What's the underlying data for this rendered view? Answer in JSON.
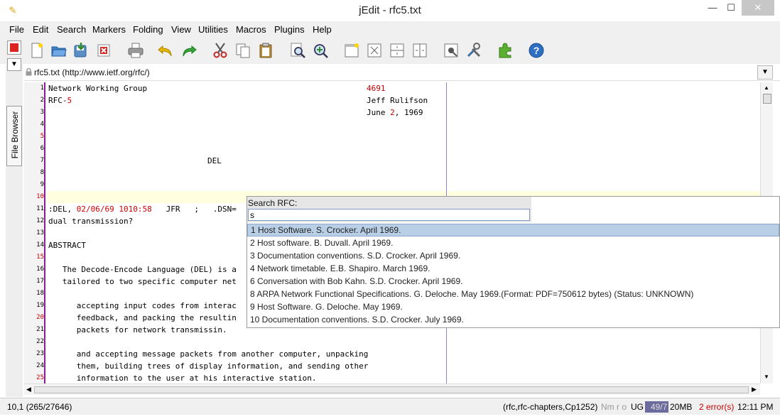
{
  "window": {
    "title": "jEdit - rfc5.txt",
    "app_icon": "jedit-icon"
  },
  "menu": [
    "File",
    "Edit",
    "Search",
    "Markers",
    "Folding",
    "View",
    "Utilities",
    "Macros",
    "Plugins",
    "Help"
  ],
  "toolbar_icons": [
    "new-file-icon",
    "open-file-icon",
    "save-icon",
    "close-file-icon",
    "print-icon",
    "undo-icon",
    "redo-icon",
    "cut-icon",
    "copy-icon",
    "paste-icon",
    "find-icon",
    "find-in-files-icon",
    "new-view-icon",
    "unsplit-icon",
    "split-horizontal-icon",
    "split-vertical-icon",
    "buffer-options-icon",
    "global-options-icon",
    "plugin-manager-icon",
    "help-icon"
  ],
  "dock": {
    "tab_label": "File Browser"
  },
  "buffer": {
    "label": "rfc5.txt (http://www.ietf.org/rfc/)"
  },
  "editor": {
    "line_numbers": [
      "1",
      "2",
      "3",
      "4",
      "5",
      "6",
      "7",
      "8",
      "9",
      "10",
      "11",
      "12",
      "13",
      "14",
      "15",
      "16",
      "17",
      "18",
      "19",
      "20",
      "21",
      "22",
      "23",
      "24",
      "25"
    ],
    "lines": {
      "l1_left": "Network Working Group",
      "l1_right": "4691",
      "l2_a": "RFC-",
      "l2_b": "5",
      "l2_right": "Jeff Rulifson",
      "l3_a": "June ",
      "l3_b": "2",
      "l3_c": ", 1969",
      "l7": "DEL",
      "l11_a": ":DEL, ",
      "l11_b": "02/06/69 1010:58",
      "l11_c": "   JFR   ;   .DSN=",
      "l12": "dual transmission?",
      "l14": "ABSTRACT",
      "l16": "   The Decode-Encode Language (DEL) is a",
      "l17": "   tailored to two specific computer net",
      "l19": "      accepting input codes from interac",
      "l20": "      feedback, and packing the resultin",
      "l21": "      packets for network transmissin.",
      "l23": "      and accepting message packets from another computer, unpacking",
      "l24": "      them, building trees of display information, and sending other",
      "l25": "      information to the user at his interactive station."
    }
  },
  "popup": {
    "label": "Search RFC:",
    "input_value": "s",
    "items": [
      "1 Host Software. S. Crocker. April 1969.",
      "2 Host software. B. Duvall. April 1969.",
      "3 Documentation conventions. S.D. Crocker. April 1969.",
      "4 Network timetable. E.B. Shapiro. March 1969.",
      "6 Conversation with Bob Kahn. S.D. Crocker. April 1969.",
      "8 ARPA Network Functional Specifications. G. Deloche. May 1969.(Format: PDF=750612 bytes) (Status: UNKNOWN)",
      "9 Host Software. G. Deloche. May 1969.",
      "10 Documentation conventions. S.D. Crocker. July 1969."
    ],
    "selected_index": 0
  },
  "status": {
    "caret": "10,1 (265/27646)",
    "mode": "(rfc,rfc-chapters,Cp1252)",
    "flags": "Nm r o",
    "encoding": "UG",
    "memory_bar": "49/7",
    "memory": "20MB",
    "errors": "2 error(s)",
    "time": "12:11 PM"
  }
}
